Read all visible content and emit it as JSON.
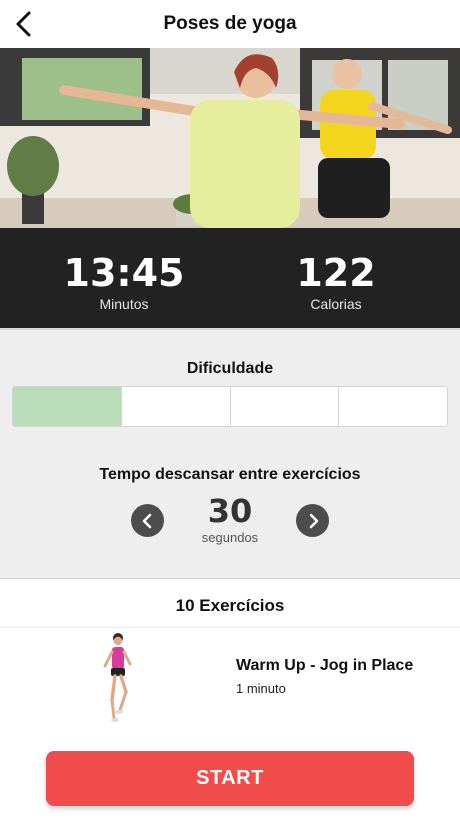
{
  "header": {
    "title": "Poses de yoga",
    "back_icon": "chevron-left-icon"
  },
  "stats": {
    "duration": {
      "value": "13:45",
      "label": "Minutos"
    },
    "calories": {
      "value": "122",
      "label": "Calorias"
    }
  },
  "difficulty": {
    "title": "Dificuldade",
    "levels_total": 4,
    "level_selected": 1,
    "active_color": "#b9ddb7"
  },
  "rest": {
    "title": "Tempo descansar entre exercícios",
    "value": "30",
    "unit": "segundos",
    "decrease_icon": "chevron-left-icon",
    "increase_icon": "chevron-right-icon"
  },
  "exercises": {
    "count_label": "10 Exercícios",
    "items": [
      {
        "name": "Warm Up - Jog in Place",
        "duration": "1 minuto"
      }
    ]
  },
  "start_button": {
    "label": "START",
    "color": "#f04c4c"
  },
  "colors": {
    "stats_bg": "#222222",
    "settings_bg": "#eeeeee"
  }
}
